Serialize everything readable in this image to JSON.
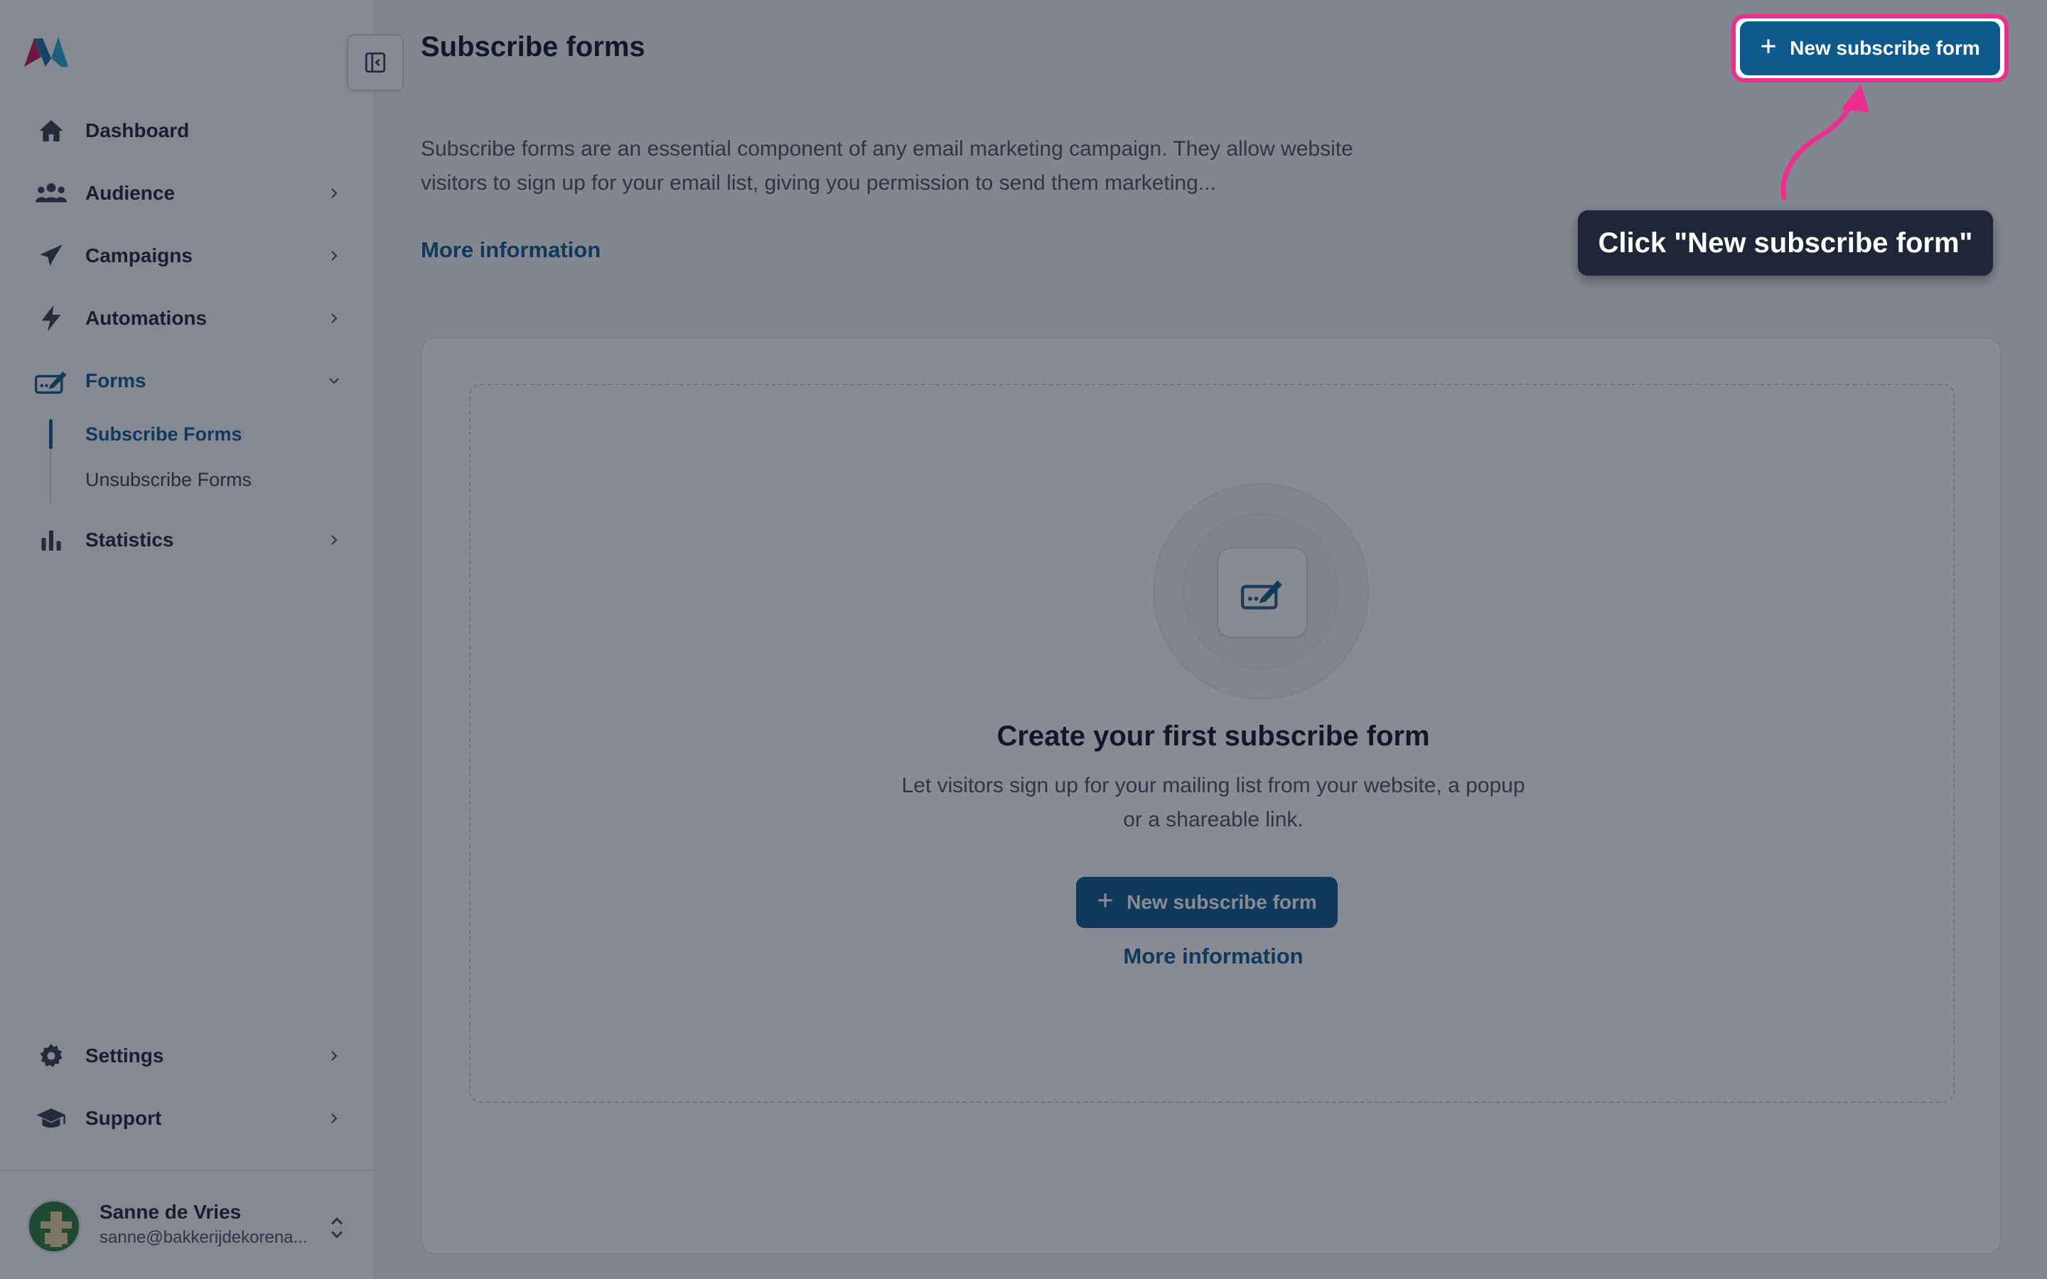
{
  "sidebar": {
    "logo": "m-logo",
    "collapse_icon": "sidebar-collapse-icon",
    "items": [
      {
        "label": "Dashboard",
        "icon": "home-icon",
        "has_chevron": false
      },
      {
        "label": "Audience",
        "icon": "users-icon",
        "has_chevron": true
      },
      {
        "label": "Campaigns",
        "icon": "paper-plane-icon",
        "has_chevron": true
      },
      {
        "label": "Automations",
        "icon": "bolt-icon",
        "has_chevron": true
      },
      {
        "label": "Forms",
        "icon": "form-edit-icon",
        "has_chevron": true,
        "expanded": true,
        "active": true
      },
      {
        "label": "Statistics",
        "icon": "bar-chart-icon",
        "has_chevron": true
      }
    ],
    "forms_sub": [
      {
        "label": "Subscribe Forms",
        "active": true
      },
      {
        "label": "Unsubscribe Forms",
        "active": false
      }
    ],
    "bottom_items": [
      {
        "label": "Settings",
        "icon": "gear-icon"
      },
      {
        "label": "Support",
        "icon": "graduation-cap-icon"
      }
    ],
    "user": {
      "name": "Sanne de Vries",
      "email": "sanne@bakkerijdekorena..."
    }
  },
  "header": {
    "title": "Subscribe forms",
    "new_button": "New subscribe form"
  },
  "intro": {
    "text": "Subscribe forms are an essential component of any email marketing campaign. They allow website visitors to sign up for your email list, giving you permission to send them marketing...",
    "more_link": "More information"
  },
  "empty_state": {
    "icon": "form-edit-icon",
    "title": "Create your first subscribe form",
    "description": "Let visitors sign up for your mailing list from your website, a popup or a shareable link.",
    "button": "New subscribe form",
    "more_link": "More information"
  },
  "tour": {
    "callout": "Click \"New subscribe form\"",
    "highlight_color": "#ec2f8e"
  },
  "colors": {
    "accent": "#0f5a8c",
    "overlay": "rgba(17,24,39,0.5)",
    "callout_bg": "#1e2638"
  }
}
